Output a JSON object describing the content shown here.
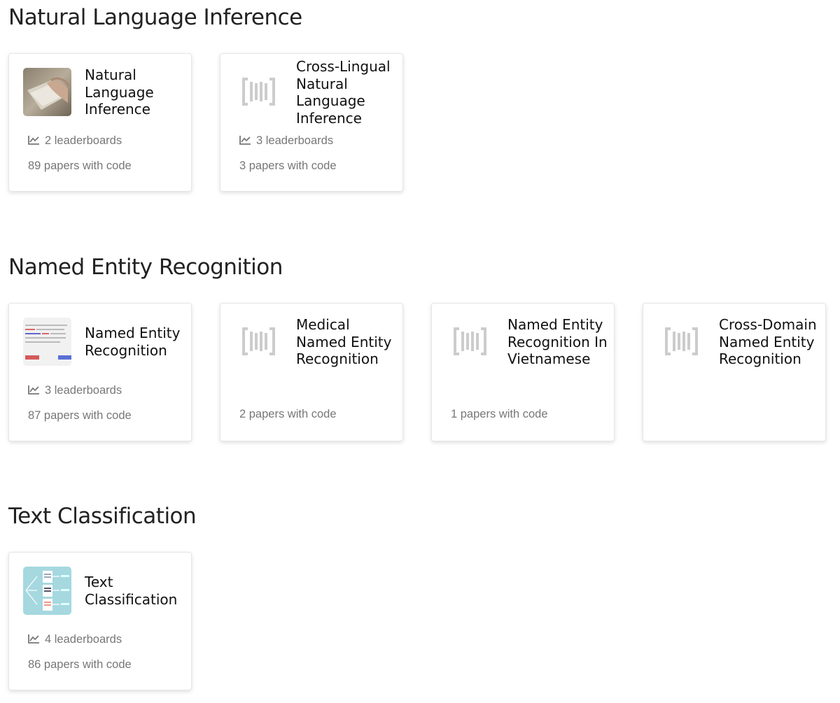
{
  "sections": [
    {
      "title": "Natural Language Inference",
      "cards": [
        {
          "title": "Natural Language Inference",
          "leaderboards": "2 leaderboards",
          "papers": "89 papers with code",
          "thumb": "photo-thumbnail"
        },
        {
          "title": "Cross-Lingual Natural Language Inference",
          "leaderboards": "3 leaderboards",
          "papers": "3 papers with code",
          "thumb": "placeholder-icon"
        }
      ]
    },
    {
      "title": "Named Entity Recognition",
      "cards": [
        {
          "title": "Named Entity Recognition",
          "leaderboards": "3 leaderboards",
          "papers": "87 papers with code",
          "thumb": "ner-thumbnail"
        },
        {
          "title": "Medical Named Entity Recognition",
          "papers": "2 papers with code",
          "thumb": "placeholder-icon"
        },
        {
          "title": "Named Entity Recognition In Vietnamese",
          "papers": "1 papers with code",
          "thumb": "placeholder-icon"
        },
        {
          "title": "Cross-Domain Named Entity Recognition",
          "thumb": "placeholder-icon"
        }
      ]
    },
    {
      "title": "Text Classification",
      "cards": [
        {
          "title": "Text Classification",
          "leaderboards": "4 leaderboards",
          "papers": "86 papers with code",
          "thumb": "classification-thumbnail"
        }
      ]
    }
  ],
  "colors": {
    "muted_text": "#777777",
    "title_text": "#222222",
    "placeholder_icon": "#cccccc",
    "class_thumb_bg": "#a6d8e0"
  }
}
